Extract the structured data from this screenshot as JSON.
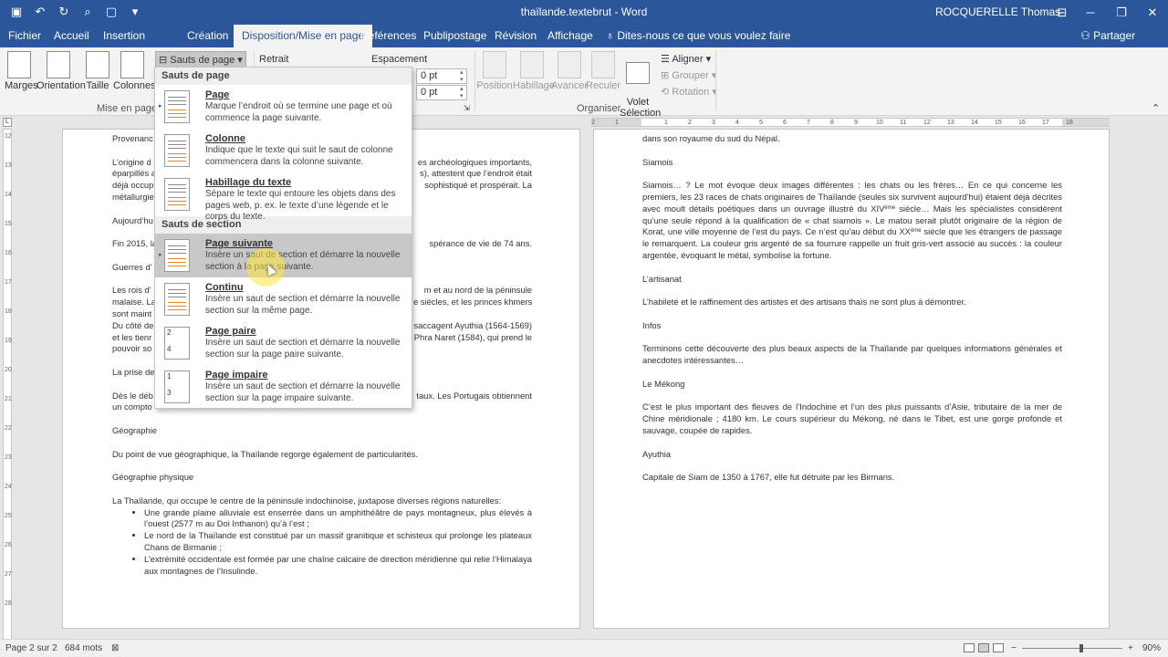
{
  "app": {
    "window_title": "thaïlande.textebrut - Word",
    "user": "ROCQUERELLE Thomas",
    "qat_icons": [
      "save-icon",
      "undo-icon",
      "redo-icon",
      "print-preview-icon",
      "new-document-icon",
      "customize-qat-icon"
    ],
    "window_controls": [
      "ribbon-display-icon",
      "minimize-icon",
      "restore-icon",
      "close-icon"
    ]
  },
  "tabs": [
    {
      "label": "Fichier",
      "active": false
    },
    {
      "label": "Accueil",
      "active": false
    },
    {
      "label": "Insertion",
      "active": false
    },
    {
      "label": "Création",
      "active": false
    },
    {
      "label": "Disposition/Mise en page",
      "active": true
    },
    {
      "label": "Références",
      "active": false
    },
    {
      "label": "Publipostage",
      "active": false
    },
    {
      "label": "Révision",
      "active": false
    },
    {
      "label": "Affichage",
      "active": false
    }
  ],
  "tell_me": "Dites-nous ce que vous voulez faire",
  "share": "Partager",
  "ribbon": {
    "page_setup": {
      "margins": "Marges",
      "orientation": "Orientation",
      "size": "Taille",
      "columns": "Colonnes",
      "breaks": "Sauts de page",
      "group_label": "Mise en page"
    },
    "paragraph": {
      "indent": "Retrait",
      "spacing": "Espacement",
      "spacing_before": "0 pt",
      "spacing_after": "0 pt"
    },
    "arrange": {
      "position": "Position",
      "wrap": "Habillage",
      "forward": "Avancer",
      "backward": "Reculer",
      "selection_pane": "Volet\nSélection",
      "align": "Aligner",
      "group": "Grouper",
      "rotate": "Rotation",
      "group_label": "Organiser"
    }
  },
  "breaks_menu": {
    "page_breaks_header": "Sauts de page",
    "section_breaks_header": "Sauts de section",
    "items": [
      {
        "title": "Page",
        "desc": "Marque l’endroit où se termine une page et où commence la page suivante."
      },
      {
        "title": "Colonne",
        "desc": "Indique que le texte qui suit le saut de colonne commencera dans la colonne suivante."
      },
      {
        "title": "Habillage du texte",
        "desc": "Sépare le texte qui entoure les objets dans des pages web, p. ex. le texte d’une légende et le corps du texte."
      },
      {
        "title": "Page suivante",
        "desc": "Insère un saut de section et démarre la nouvelle section à la page suivante."
      },
      {
        "title": "Continu",
        "desc": "Insère un saut de section et démarre la nouvelle section sur la même page."
      },
      {
        "title": "Page paire",
        "desc": "Insère un saut de section et démarre la nouvelle section sur la page paire suivante."
      },
      {
        "title": "Page impaire",
        "desc": "Insère un saut de section et démarre la nouvelle section sur la page impaire suivante."
      }
    ],
    "icon_numbers": {
      "even": "2",
      "even2": "4",
      "odd": "1",
      "odd2": "3"
    }
  },
  "page1": {
    "lines": [
      "Provenanc",
      "L’origine d",
      "éparpillés a",
      "déjà occup",
      "métallurgie",
      "Aujourd’hu",
      "Fin 2015, la",
      "Guerres d’",
      "Les rois d’",
      "malaise. La",
      "sont maint",
      "Du côté de",
      "et les tienr",
      "pouvoir so",
      "La prise de",
      "Dès le déb",
      "un compto"
    ],
    "right_lines": [
      "es archéologiques importants,",
      "s), attestent que l’endroit était",
      "sophistiqué et prospérait. La",
      "spérance de vie de 74 ans.",
      "m et au nord de la péninsule",
      "e siècles, et les princes khmers",
      "saccagent Ayuthia (1564-1569)",
      "Phra Naret (1584), qui prend le",
      "taux. Les Portugais obtiennent"
    ],
    "geo_title": "Géographie",
    "geo_text": "Du point de vue géographique, la Thaïlande regorge également de particularités.",
    "geo_phys_title": "Géographie physique",
    "geo_phys_text": "La Thaïlande, qui occupe le centre de la péninsule indochinoise, juxtapose diverses régions naturelles:",
    "bullets": [
      "Une grande plaine alluviale est enserrée dans un amphithéâtre de pays montagneux, plus élevés à l’ouest (2577 m au Doi Inthanon) qu’à l’est ;",
      "Le nord de la Thaïlande est constitué par un massif granitique et schisteux qui prolonge les plateaux Chans de Birmanie ;",
      "L’extrémité occidentale est formée par une chaîne calcaire de direction méridienne qui relie l’Himalaya aux montagnes de l’Insulinde."
    ]
  },
  "page2": {
    "l0": "dans son royaume du sud du Népal.",
    "siamois_title": "Siamois",
    "siamois_a": "Siamois… ? Le mot évoque deux images différentes : les chats ou les frères… En ce qui concerne les premiers, les 23 races de chats originaires de Thaïlande (seules six survivent aujourd’hui) étaient déjà décrites avec moult détails poétiques dans un ouvrage illustré du XIV",
    "sup1": "ème",
    "siamois_b": " siècle… Mais les spécialistes considèrent qu’une seule répond à la qualification de « chat siamois ». Le matou serait plutôt originaire de la région de Korat, une ville moyenne de l’est du pays. Ce n’est qu’au début du XX",
    "sup2": "ème",
    "siamois_c": " siècle que les étrangers de passage le remarquent. La couleur gris argenté de sa fourrure rappelle un fruit gris-vert associé au succès : la couleur argentée, évoquant le métal, symbolise la fortune.",
    "artisanat_title": "L’artisanat",
    "artisanat_text": "L’habileté et le raffinement des artistes et des artisans thaïs ne sont plus à démontrer.",
    "infos_title": "Infos",
    "infos_text": "Terminons cette découverte des plus beaux aspects de la Thaïlande par quelques informations générales et anecdotes intéressantes…",
    "mekong_title": "Le Mékong",
    "mekong_text": "C’est le plus important des fleuves de l’Indochine et l’un des plus puissants d’Asie, tributaire de la mer de Chine méridionale ; 4180 km. Le cours supérieur du Mékong, né dans le Tibet, est une gorge profonde et sauvage, coupée de rapides.",
    "ayuthia_title": "Ayuthia",
    "ayuthia_text": "Capitale de Siam de 1350 à 1767, elle fut détruite par les Birmans."
  },
  "ruler": {
    "top_ticks": [
      "2",
      "1",
      "1",
      "2",
      "3",
      "4",
      "5",
      "6",
      "7",
      "8",
      "9",
      "10",
      "11",
      "12",
      "13",
      "14",
      "15",
      "16",
      "17",
      "18"
    ],
    "left_ticks": [
      "12",
      "13",
      "14",
      "15",
      "16",
      "17",
      "18",
      "19",
      "20",
      "21",
      "22",
      "23",
      "24",
      "25",
      "26",
      "27",
      "28"
    ]
  },
  "status": {
    "page": "Page 2 sur 2",
    "words": "684 mots",
    "zoom": "90%",
    "zoom_minus": "−",
    "zoom_plus": "+"
  }
}
